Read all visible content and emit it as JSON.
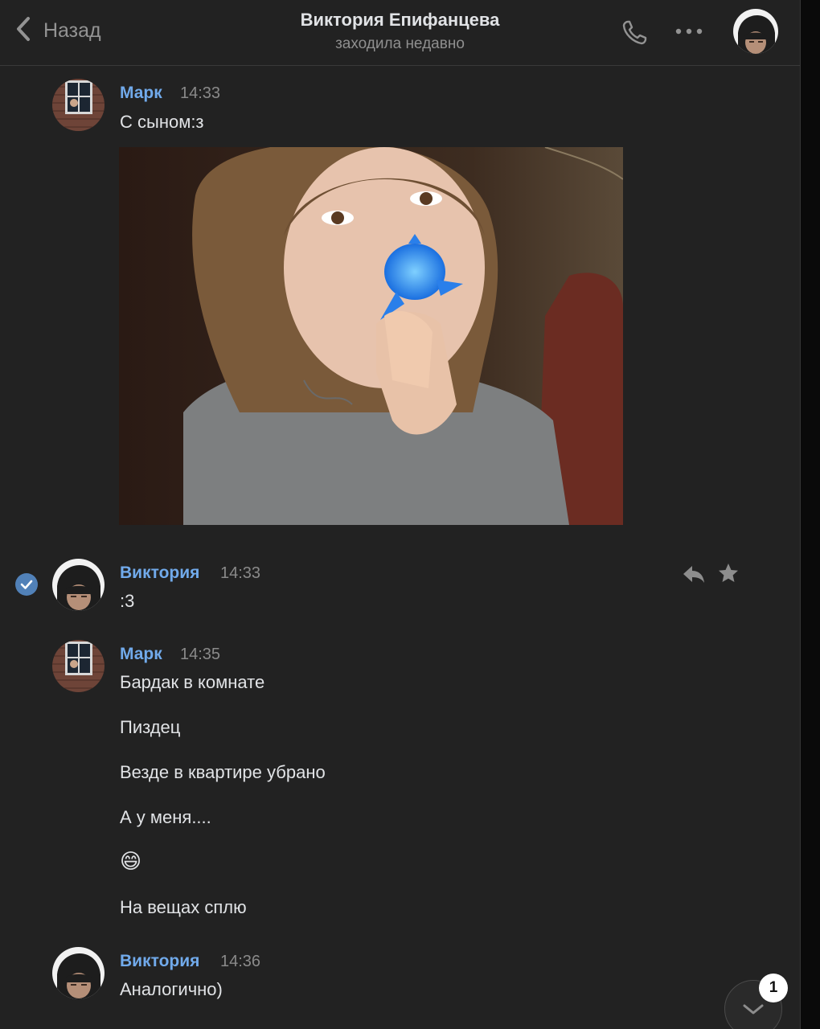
{
  "header": {
    "back_label": "Назад",
    "title": "Виктория Епифанцева",
    "status": "заходила недавно"
  },
  "icons": {
    "back": "chevron-left-icon",
    "call": "phone-icon",
    "more": "more-horizontal-icon",
    "reply": "reply-icon",
    "favorite": "star-icon",
    "selected": "check-circle-icon",
    "scroll_down": "chevron-down-icon"
  },
  "colors": {
    "background": "#222222",
    "author_name": "#71aaeb",
    "text": "#e1e3e6",
    "muted": "#8a8a8a",
    "accent": "#5181b8"
  },
  "messages": [
    {
      "author": "Марк",
      "time": "14:33",
      "lines": [
        "С сыном:з"
      ],
      "has_photo": true
    },
    {
      "author": "Виктория",
      "time": "14:33",
      "lines": [
        ":3"
      ],
      "selected": true
    },
    {
      "author": "Марк",
      "time": "14:35",
      "lines": [
        "Бардак в комнате",
        "Пиздец",
        "Везде в квартире убрано",
        "А у меня....",
        "😄",
        "На вещах сплю"
      ]
    },
    {
      "author": "Виктория",
      "time": "14:36",
      "lines": [
        "Аналогично)"
      ]
    }
  ],
  "unread_badge": "1"
}
